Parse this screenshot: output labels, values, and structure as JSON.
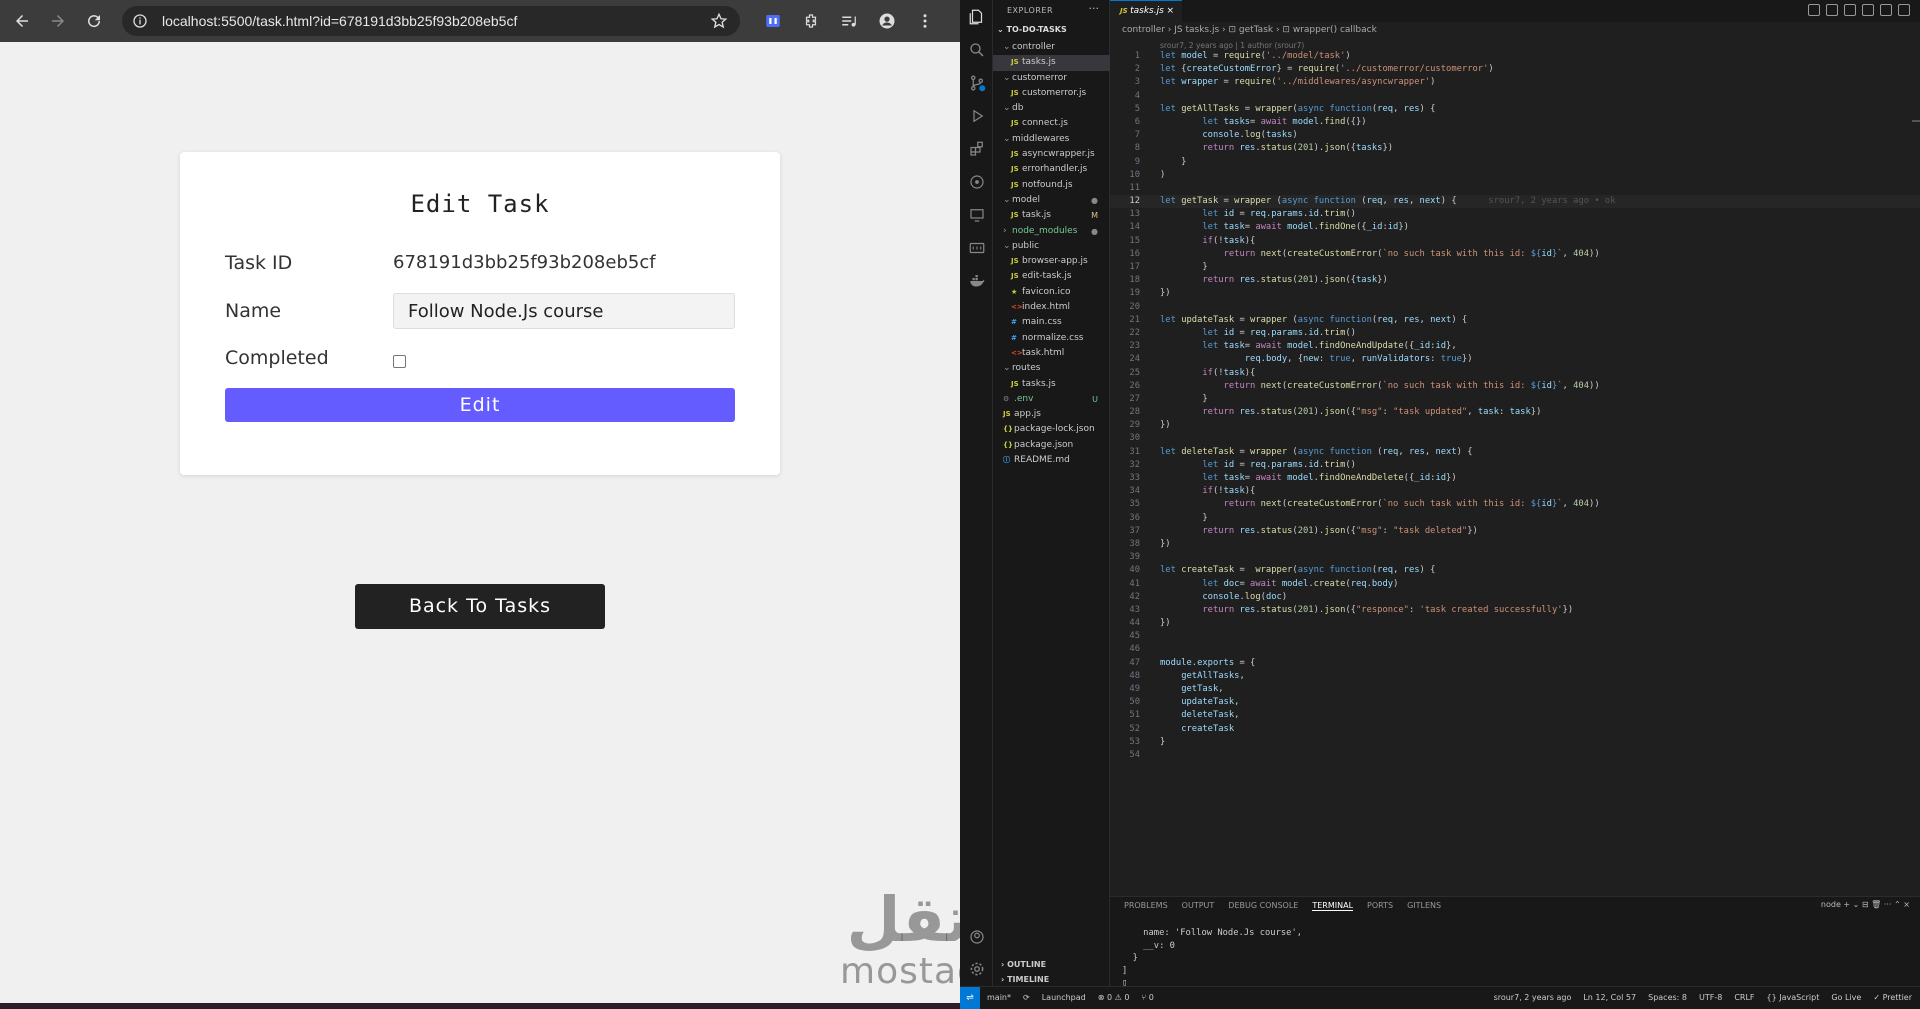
{
  "browser": {
    "url": "localhost:5500/task.html?id=678191d3bb25f93b208eb5cf",
    "page": {
      "title": "Edit Task",
      "task_id_label": "Task ID",
      "task_id_value": "678191d3bb25f93b208eb5cf",
      "name_label": "Name",
      "name_value": "Follow Node.Js course",
      "completed_label": "Completed",
      "completed_checked": false,
      "edit_button": "Edit",
      "back_button": "Back To Tasks"
    },
    "watermark": {
      "arabic": "مستقل",
      "latin": "mostaql.com"
    }
  },
  "vscode": {
    "explorer_title": "EXPLORER",
    "explorer_more": "···",
    "root_folder": "TO-DO-TASKS",
    "tree": [
      {
        "label": "controller",
        "type": "folder",
        "depth": 0
      },
      {
        "label": "tasks.js",
        "type": "js",
        "depth": 1,
        "active": true
      },
      {
        "label": "customerror",
        "type": "folder",
        "depth": 0
      },
      {
        "label": "customerror.js",
        "type": "js",
        "depth": 1
      },
      {
        "label": "db",
        "type": "folder",
        "depth": 0
      },
      {
        "label": "connect.js",
        "type": "js",
        "depth": 1
      },
      {
        "label": "middlewares",
        "type": "folder",
        "depth": 0
      },
      {
        "label": "asyncwrapper.js",
        "type": "js",
        "depth": 1
      },
      {
        "label": "errorhandler.js",
        "type": "js",
        "depth": 1
      },
      {
        "label": "notfound.js",
        "type": "js",
        "depth": 1
      },
      {
        "label": "model",
        "type": "folder",
        "depth": 0,
        "badge": "●"
      },
      {
        "label": "task.js",
        "type": "js",
        "depth": 1,
        "badge": "M"
      },
      {
        "label": "node_modules",
        "type": "folder-closed",
        "depth": 0,
        "badge": "●",
        "color": "#73c991"
      },
      {
        "label": "public",
        "type": "folder",
        "depth": 0
      },
      {
        "label": "browser-app.js",
        "type": "js",
        "depth": 1
      },
      {
        "label": "edit-task.js",
        "type": "js",
        "depth": 1
      },
      {
        "label": "favicon.ico",
        "type": "ico",
        "depth": 1
      },
      {
        "label": "index.html",
        "type": "html",
        "depth": 1
      },
      {
        "label": "main.css",
        "type": "css",
        "depth": 1
      },
      {
        "label": "normalize.css",
        "type": "css",
        "depth": 1
      },
      {
        "label": "task.html",
        "type": "html",
        "depth": 1
      },
      {
        "label": "routes",
        "type": "folder",
        "depth": 0
      },
      {
        "label": "tasks.js",
        "type": "js",
        "depth": 1
      },
      {
        "label": ".env",
        "type": "env",
        "depth": 0,
        "badge": "U",
        "color": "#73c991"
      },
      {
        "label": "app.js",
        "type": "js",
        "depth": 0
      },
      {
        "label": "package-lock.json",
        "type": "json",
        "depth": 0
      },
      {
        "label": "package.json",
        "type": "json",
        "depth": 0
      },
      {
        "label": "README.md",
        "type": "md",
        "depth": 0
      }
    ],
    "outline": "OUTLINE",
    "timeline": "TIMELINE",
    "tab": {
      "label": "tasks.js",
      "close": "×"
    },
    "breadcrumb": "controller  ›  JS tasks.js  ›  ⊡ getTask  ›  ⊡ wrapper() callback",
    "blame": "srour7, 2 years ago | 1 author (srour7)",
    "code": [
      "<span class=\"kw\">let</span> <span class=\"vr\">model</span> = <span class=\"fn\">require</span>(<span class=\"str\">'../model/task'</span>)",
      "<span class=\"kw\">let</span> {<span class=\"vr\">createCustomError</span>} = <span class=\"fn\">require</span>(<span class=\"str\">'../customerror/customerror'</span>)",
      "<span class=\"kw\">let</span> <span class=\"vr\">wrapper</span> = <span class=\"fn\">require</span>(<span class=\"str\">'../middlewares/asyncwrapper'</span>)",
      "",
      "<span class=\"kw\">let</span> <span class=\"fn\">getAllTasks</span> = <span class=\"fn\">wrapper</span>(<span class=\"kw\">async function</span>(<span class=\"vr\">req</span>, <span class=\"vr\">res</span>) {",
      "        <span class=\"kw\">let</span> <span class=\"vr\">tasks</span>= <span class=\"ctl\">await</span> <span class=\"vr\">model</span>.<span class=\"fn\">find</span>({})",
      "        <span class=\"vr\">console</span>.<span class=\"fn\">log</span>(<span class=\"vr\">tasks</span>)",
      "        <span class=\"ctl\">return</span> <span class=\"vr\">res</span>.<span class=\"fn\">status</span>(<span class=\"num\">201</span>).<span class=\"fn\">json</span>({<span class=\"vr\">tasks</span>})",
      "    }",
      ")",
      "",
      "<span class=\"kw\">let</span> <span class=\"fn\">getTask</span> = <span class=\"fn\">wrapper</span> (<span class=\"kw\">async function</span> (<span class=\"vr\">req</span>, <span class=\"vr\">res</span>, <span class=\"vr\">next</span>) {      <span class=\"ghost\">srour7, 2 years ago • ok</span>",
      "        <span class=\"kw\">let</span> <span class=\"vr\">id</span> = <span class=\"vr\">req</span>.<span class=\"vr\">params</span>.<span class=\"vr\">id</span>.<span class=\"fn\">trim</span>()",
      "        <span class=\"kw\">let</span> <span class=\"vr\">task</span>= <span class=\"ctl\">await</span> <span class=\"vr\">model</span>.<span class=\"fn\">findOne</span>({<span class=\"vr\">_id</span>:<span class=\"vr\">id</span>})",
      "        <span class=\"ctl\">if</span>(!<span class=\"vr\">task</span>){",
      "            <span class=\"ctl\">return</span> <span class=\"fn\">next</span>(<span class=\"fn\">createCustomError</span>(<span class=\"str\">`no such task with this id: </span><span class=\"kw\">${</span><span class=\"vr\">id</span><span class=\"kw\">}</span><span class=\"str\">`</span>, <span class=\"num\">404</span>))",
      "        }",
      "        <span class=\"ctl\">return</span> <span class=\"vr\">res</span>.<span class=\"fn\">status</span>(<span class=\"num\">201</span>).<span class=\"fn\">json</span>({<span class=\"vr\">task</span>})",
      "})",
      "",
      "<span class=\"kw\">let</span> <span class=\"fn\">updateTask</span> = <span class=\"fn\">wrapper</span> (<span class=\"kw\">async function</span>(<span class=\"vr\">req</span>, <span class=\"vr\">res</span>, <span class=\"vr\">next</span>) {",
      "        <span class=\"kw\">let</span> <span class=\"vr\">id</span> = <span class=\"vr\">req</span>.<span class=\"vr\">params</span>.<span class=\"vr\">id</span>.<span class=\"fn\">trim</span>()",
      "        <span class=\"kw\">let</span> <span class=\"vr\">task</span>= <span class=\"ctl\">await</span> <span class=\"vr\">model</span>.<span class=\"fn\">findOneAndUpdate</span>({<span class=\"vr\">_id</span>:<span class=\"vr\">id</span>},",
      "                <span class=\"vr\">req</span>.<span class=\"vr\">body</span>, {<span class=\"vr\">new</span>: <span class=\"kw\">true</span>, <span class=\"vr\">runValidators</span>: <span class=\"kw\">true</span>})",
      "        <span class=\"ctl\">if</span>(!<span class=\"vr\">task</span>){",
      "            <span class=\"ctl\">return</span> <span class=\"fn\">next</span>(<span class=\"fn\">createCustomError</span>(<span class=\"str\">`no such task with this id: </span><span class=\"kw\">${</span><span class=\"vr\">id</span><span class=\"kw\">}</span><span class=\"str\">`</span>, <span class=\"num\">404</span>))",
      "        }",
      "        <span class=\"ctl\">return</span> <span class=\"vr\">res</span>.<span class=\"fn\">status</span>(<span class=\"num\">201</span>).<span class=\"fn\">json</span>({<span class=\"str\">\"msg\"</span>: <span class=\"str\">\"task updated\"</span>, <span class=\"vr\">task</span>: <span class=\"vr\">task</span>})",
      "})",
      "",
      "<span class=\"kw\">let</span> <span class=\"fn\">deleteTask</span> = <span class=\"fn\">wrapper</span> (<span class=\"kw\">async function</span> (<span class=\"vr\">req</span>, <span class=\"vr\">res</span>, <span class=\"vr\">next</span>) {",
      "        <span class=\"kw\">let</span> <span class=\"vr\">id</span> = <span class=\"vr\">req</span>.<span class=\"vr\">params</span>.<span class=\"vr\">id</span>.<span class=\"fn\">trim</span>()",
      "        <span class=\"kw\">let</span> <span class=\"vr\">task</span>= <span class=\"ctl\">await</span> <span class=\"vr\">model</span>.<span class=\"fn\">findOneAndDelete</span>({<span class=\"vr\">_id</span>:<span class=\"vr\">id</span>})",
      "        <span class=\"ctl\">if</span>(!<span class=\"vr\">task</span>){",
      "            <span class=\"ctl\">return</span> <span class=\"fn\">next</span>(<span class=\"fn\">createCustomError</span>(<span class=\"str\">`no such task with this id: </span><span class=\"kw\">${</span><span class=\"vr\">id</span><span class=\"kw\">}</span><span class=\"str\">`</span>, <span class=\"num\">404</span>))",
      "        }",
      "        <span class=\"ctl\">return</span> <span class=\"vr\">res</span>.<span class=\"fn\">status</span>(<span class=\"num\">201</span>).<span class=\"fn\">json</span>({<span class=\"str\">\"msg\"</span>: <span class=\"str\">\"task deleted\"</span>})",
      "})",
      "",
      "<span class=\"kw\">let</span> <span class=\"fn\">createTask</span> =  <span class=\"fn\">wrapper</span>(<span class=\"kw\">async function</span>(<span class=\"vr\">req</span>, <span class=\"vr\">res</span>) {",
      "        <span class=\"kw\">let</span> <span class=\"vr\">doc</span>= <span class=\"ctl\">await</span> <span class=\"vr\">model</span>.<span class=\"fn\">create</span>(<span class=\"vr\">req</span>.<span class=\"vr\">body</span>)",
      "        <span class=\"vr\">console</span>.<span class=\"fn\">log</span>(<span class=\"vr\">doc</span>)",
      "        <span class=\"ctl\">return</span> <span class=\"vr\">res</span>.<span class=\"fn\">status</span>(<span class=\"num\">201</span>).<span class=\"fn\">json</span>({<span class=\"str\">\"responce\"</span>: <span class=\"str\">'task created successfully'</span>})",
      "})",
      "",
      "",
      "<span class=\"vr\">module</span>.<span class=\"vr\">exports</span> = {",
      "    <span class=\"vr\">getAllTasks</span>,",
      "    <span class=\"vr\">getTask</span>,",
      "    <span class=\"vr\">updateTask</span>,",
      "    <span class=\"vr\">deleteTask</span>,",
      "    <span class=\"vr\">createTask</span>",
      "}",
      ""
    ],
    "current_line": 12,
    "panel_tabs": [
      "PROBLEMS",
      "OUTPUT",
      "DEBUG CONSOLE",
      "TERMINAL",
      "PORTS",
      "GITLENS"
    ],
    "active_panel_tab": "TERMINAL",
    "panel_actions": "node  +  ⌄  ⊟  🗑  ···  ⌃  ×",
    "terminal_lines": [
      "    name: 'Follow Node.Js course',",
      "    __v: 0",
      "  }",
      "]",
      "▯"
    ],
    "status_left": [
      "main*",
      "⟳",
      "Launchpad",
      "⊗ 0 ⚠ 0",
      "⑂ 0"
    ],
    "status_right": [
      "srour7, 2 years ago",
      "Ln 12, Col 57",
      "Spaces: 8",
      "UTF-8",
      "CRLF",
      "{} JavaScript",
      "Go Live",
      "✓ Prettier"
    ],
    "accent": "#0078d4"
  }
}
